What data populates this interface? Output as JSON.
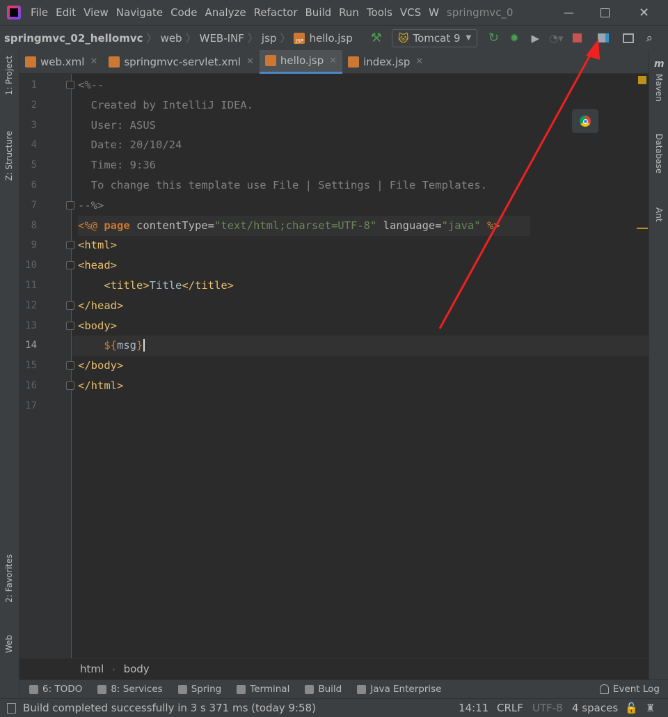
{
  "titlebar": {
    "menu": [
      "File",
      "Edit",
      "View",
      "Navigate",
      "Code",
      "Analyze",
      "Refactor",
      "Build",
      "Run",
      "Tools",
      "VCS",
      "W"
    ],
    "project_title": "springmvc_0"
  },
  "navbar": {
    "breadcrumb": [
      "springmvc_02_hellomvc",
      "web",
      "WEB-INF",
      "jsp",
      "hello.jsp"
    ],
    "run_config": "Tomcat 9"
  },
  "tabs": [
    {
      "label": "web.xml",
      "active": false
    },
    {
      "label": "springmvc-servlet.xml",
      "active": false
    },
    {
      "label": "hello.jsp",
      "active": true
    },
    {
      "label": "index.jsp",
      "active": false
    }
  ],
  "left_strip": {
    "project": "1: Project",
    "structure": "Z: Structure",
    "favorites": "2: Favorites",
    "web": "Web"
  },
  "right_strip": {
    "maven": "Maven",
    "database": "Database",
    "ant": "Ant"
  },
  "editor": {
    "current_line": 14,
    "lines": [
      [
        [
          "<%--",
          "#808080"
        ]
      ],
      [
        [
          "  Created by IntelliJ IDEA.",
          "#808080"
        ]
      ],
      [
        [
          "  User: ASUS",
          "#808080"
        ]
      ],
      [
        [
          "  Date: 20/10/24",
          "#808080"
        ]
      ],
      [
        [
          "  Time: 9:36",
          "#808080"
        ]
      ],
      [
        [
          "  To change this template use File | Settings | File Templates.",
          "#808080"
        ]
      ],
      [
        [
          "--%>",
          "#808080"
        ]
      ],
      [
        [
          "<%@ ",
          "#cc7832"
        ],
        [
          "page",
          "#cc7832"
        ],
        [
          " contentType=",
          "#bababa"
        ],
        [
          "\"text/html;charset=UTF-8\"",
          "#6a8759"
        ],
        [
          " language=",
          "#bababa"
        ],
        [
          "\"java\"",
          "#6a8759"
        ],
        [
          " %>",
          "#cc7832"
        ]
      ],
      [
        [
          "<html>",
          "#e8bf6a"
        ]
      ],
      [
        [
          "<head>",
          "#e8bf6a"
        ]
      ],
      [
        [
          "    <title>",
          "#e8bf6a"
        ],
        [
          "Title",
          "#a9b7c6"
        ],
        [
          "</title>",
          "#e8bf6a"
        ]
      ],
      [
        [
          "</head>",
          "#e8bf6a"
        ]
      ],
      [
        [
          "<body>",
          "#e8bf6a"
        ]
      ],
      [
        [
          "    ${",
          "#cc7832"
        ],
        [
          "msg",
          "#a9b7c6"
        ],
        [
          "}",
          "#cc7832"
        ]
      ],
      [
        [
          "</body>",
          "#e8bf6a"
        ]
      ],
      [
        [
          "</html>",
          "#e8bf6a"
        ]
      ],
      []
    ]
  },
  "breadcrumb_bottom": [
    "html",
    "body"
  ],
  "tool_windows": [
    "6: TODO",
    "8: Services",
    "Spring",
    "Terminal",
    "Build",
    "Java Enterprise"
  ],
  "event_log": "Event Log",
  "status": {
    "message": "Build completed successfully in 3 s 371 ms (today 9:58)",
    "position": "14:11",
    "line_sep": "CRLF",
    "encoding": "UTF-8",
    "indent": "4 spaces"
  }
}
